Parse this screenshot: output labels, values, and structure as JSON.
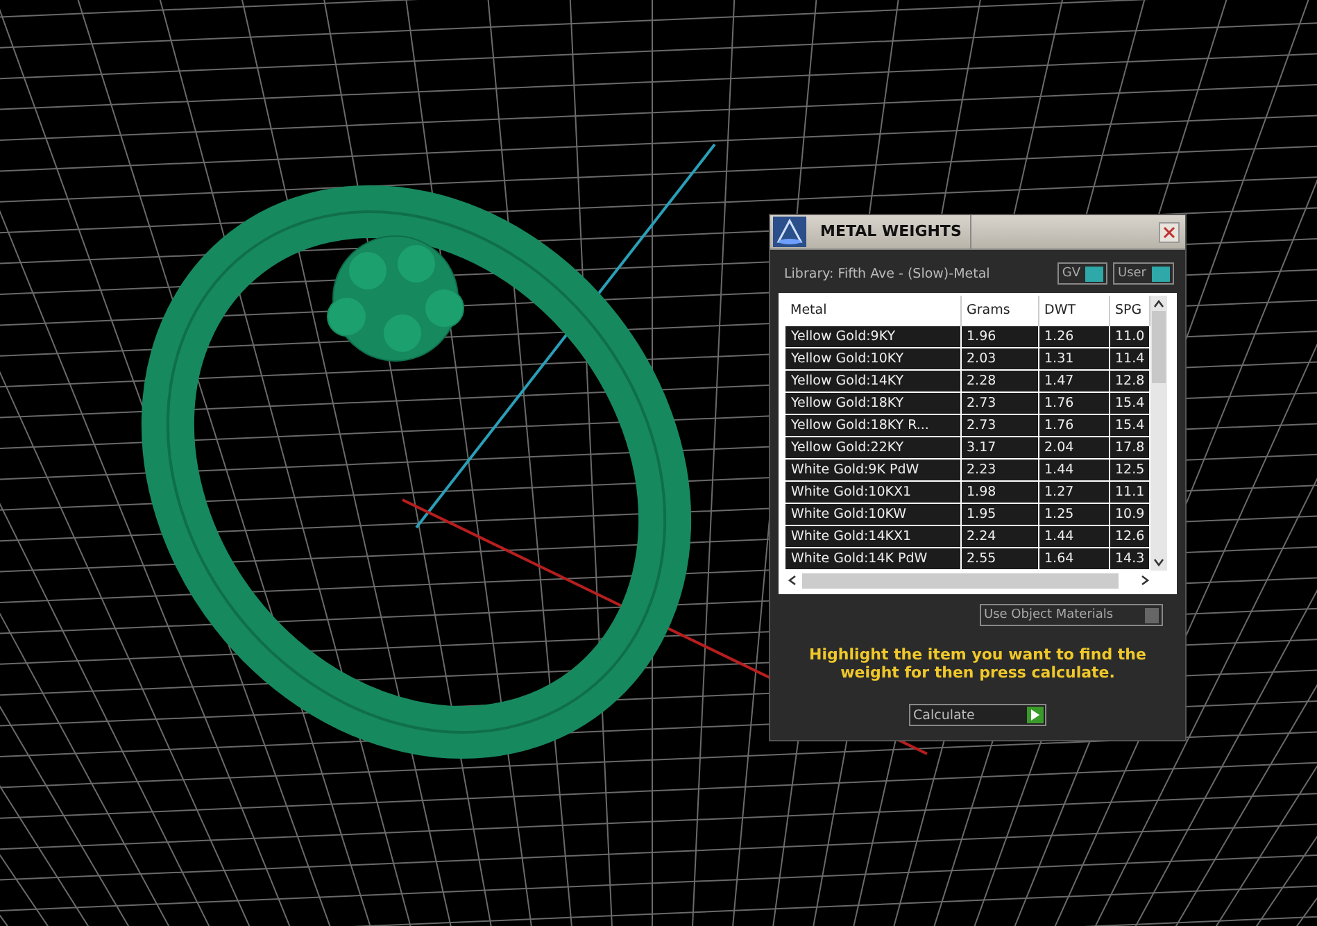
{
  "dialog": {
    "title": "METAL WEIGHTS",
    "library": "Library: Fifth Ave - (Slow)-Metal",
    "toggles": [
      {
        "label": "GV",
        "on": true
      },
      {
        "label": "User",
        "on": true
      }
    ],
    "table": {
      "columns": [
        "Metal",
        "Grams",
        "DWT",
        "SPG"
      ],
      "rows": [
        [
          "Yellow Gold:9KY",
          "1.96",
          "1.26",
          "11.0"
        ],
        [
          "Yellow Gold:10KY",
          "2.03",
          "1.31",
          "11.4"
        ],
        [
          "Yellow Gold:14KY",
          "2.28",
          "1.47",
          "12.8"
        ],
        [
          "Yellow Gold:18KY",
          "2.73",
          "1.76",
          "15.4"
        ],
        [
          "Yellow Gold:18KY R...",
          "2.73",
          "1.76",
          "15.4"
        ],
        [
          "Yellow Gold:22KY",
          "3.17",
          "2.04",
          "17.8"
        ],
        [
          "White Gold:9K PdW",
          "2.23",
          "1.44",
          "12.5"
        ],
        [
          "White Gold:10KX1",
          "1.98",
          "1.27",
          "11.1"
        ],
        [
          "White Gold:10KW",
          "1.95",
          "1.25",
          "10.9"
        ],
        [
          "White Gold:14KX1",
          "2.24",
          "1.44",
          "12.6"
        ],
        [
          "White Gold:14K PdW",
          "2.55",
          "1.64",
          "14.3"
        ]
      ]
    },
    "option": {
      "label": "Use Object Materials",
      "on": false
    },
    "instruction": "Highlight the item you want to find the weight for then press calculate.",
    "button": "Calculate"
  }
}
